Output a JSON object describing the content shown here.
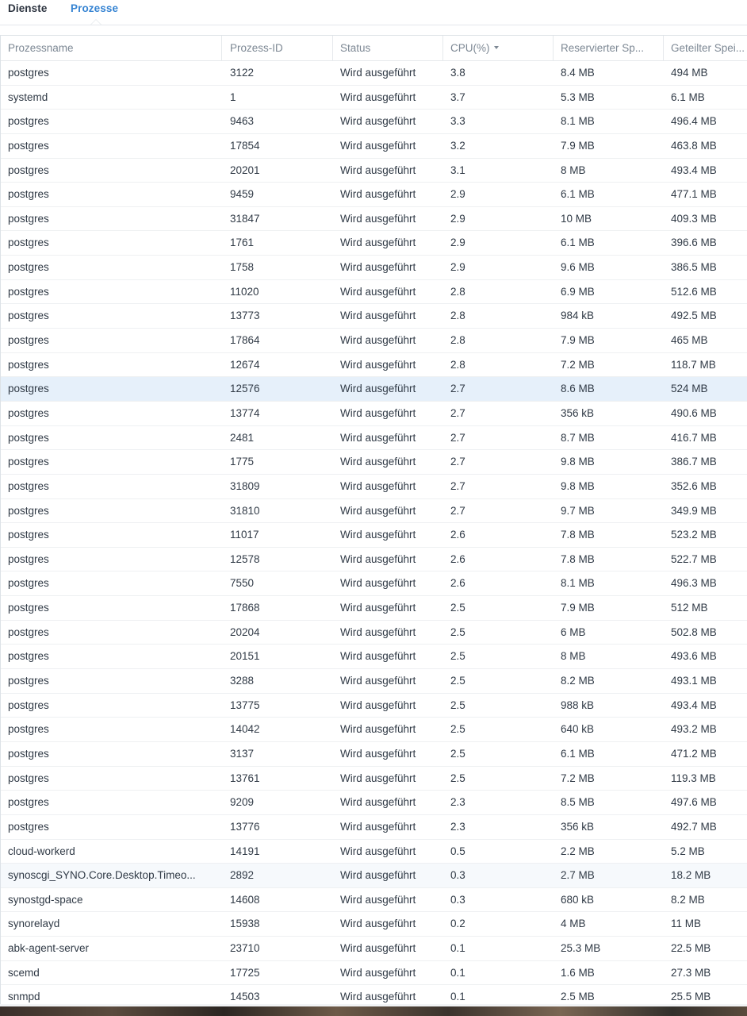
{
  "tabs": {
    "dienste": "Dienste",
    "prozesse": "Prozesse",
    "active": "Prozesse"
  },
  "table": {
    "columns": [
      "Prozessname",
      "Prozess-ID",
      "Status",
      "CPU(%)",
      "Reservierter Sp...",
      "Geteilter Spei..."
    ],
    "sort_column": "CPU(%)",
    "selected_row_index": 13,
    "rows": [
      [
        "postgres",
        "3122",
        "Wird ausgeführt",
        "3.8",
        "8.4 MB",
        "494 MB"
      ],
      [
        "systemd",
        "1",
        "Wird ausgeführt",
        "3.7",
        "5.3 MB",
        "6.1 MB"
      ],
      [
        "postgres",
        "9463",
        "Wird ausgeführt",
        "3.3",
        "8.1 MB",
        "496.4 MB"
      ],
      [
        "postgres",
        "17854",
        "Wird ausgeführt",
        "3.2",
        "7.9 MB",
        "463.8 MB"
      ],
      [
        "postgres",
        "20201",
        "Wird ausgeführt",
        "3.1",
        "8 MB",
        "493.4 MB"
      ],
      [
        "postgres",
        "9459",
        "Wird ausgeführt",
        "2.9",
        "6.1 MB",
        "477.1 MB"
      ],
      [
        "postgres",
        "31847",
        "Wird ausgeführt",
        "2.9",
        "10 MB",
        "409.3 MB"
      ],
      [
        "postgres",
        "1761",
        "Wird ausgeführt",
        "2.9",
        "6.1 MB",
        "396.6 MB"
      ],
      [
        "postgres",
        "1758",
        "Wird ausgeführt",
        "2.9",
        "9.6 MB",
        "386.5 MB"
      ],
      [
        "postgres",
        "11020",
        "Wird ausgeführt",
        "2.8",
        "6.9 MB",
        "512.6 MB"
      ],
      [
        "postgres",
        "13773",
        "Wird ausgeführt",
        "2.8",
        "984 kB",
        "492.5 MB"
      ],
      [
        "postgres",
        "17864",
        "Wird ausgeführt",
        "2.8",
        "7.9 MB",
        "465 MB"
      ],
      [
        "postgres",
        "12674",
        "Wird ausgeführt",
        "2.8",
        "7.2 MB",
        "118.7 MB"
      ],
      [
        "postgres",
        "12576",
        "Wird ausgeführt",
        "2.7",
        "8.6 MB",
        "524 MB"
      ],
      [
        "postgres",
        "13774",
        "Wird ausgeführt",
        "2.7",
        "356 kB",
        "490.6 MB"
      ],
      [
        "postgres",
        "2481",
        "Wird ausgeführt",
        "2.7",
        "8.7 MB",
        "416.7 MB"
      ],
      [
        "postgres",
        "1775",
        "Wird ausgeführt",
        "2.7",
        "9.8 MB",
        "386.7 MB"
      ],
      [
        "postgres",
        "31809",
        "Wird ausgeführt",
        "2.7",
        "9.8 MB",
        "352.6 MB"
      ],
      [
        "postgres",
        "31810",
        "Wird ausgeführt",
        "2.7",
        "9.7 MB",
        "349.9 MB"
      ],
      [
        "postgres",
        "11017",
        "Wird ausgeführt",
        "2.6",
        "7.8 MB",
        "523.2 MB"
      ],
      [
        "postgres",
        "12578",
        "Wird ausgeführt",
        "2.6",
        "7.8 MB",
        "522.7 MB"
      ],
      [
        "postgres",
        "7550",
        "Wird ausgeführt",
        "2.6",
        "8.1 MB",
        "496.3 MB"
      ],
      [
        "postgres",
        "17868",
        "Wird ausgeführt",
        "2.5",
        "7.9 MB",
        "512 MB"
      ],
      [
        "postgres",
        "20204",
        "Wird ausgeführt",
        "2.5",
        "6 MB",
        "502.8 MB"
      ],
      [
        "postgres",
        "20151",
        "Wird ausgeführt",
        "2.5",
        "8 MB",
        "493.6 MB"
      ],
      [
        "postgres",
        "3288",
        "Wird ausgeführt",
        "2.5",
        "8.2 MB",
        "493.1 MB"
      ],
      [
        "postgres",
        "13775",
        "Wird ausgeführt",
        "2.5",
        "988 kB",
        "493.4 MB"
      ],
      [
        "postgres",
        "14042",
        "Wird ausgeführt",
        "2.5",
        "640 kB",
        "493.2 MB"
      ],
      [
        "postgres",
        "3137",
        "Wird ausgeführt",
        "2.5",
        "6.1 MB",
        "471.2 MB"
      ],
      [
        "postgres",
        "13761",
        "Wird ausgeführt",
        "2.5",
        "7.2 MB",
        "119.3 MB"
      ],
      [
        "postgres",
        "9209",
        "Wird ausgeführt",
        "2.3",
        "8.5 MB",
        "497.6 MB"
      ],
      [
        "postgres",
        "13776",
        "Wird ausgeführt",
        "2.3",
        "356 kB",
        "492.7 MB"
      ],
      [
        "cloud-workerd",
        "14191",
        "Wird ausgeführt",
        "0.5",
        "2.2 MB",
        "5.2 MB"
      ],
      [
        "synoscgi_SYNO.Core.Desktop.Timeo...",
        "2892",
        "Wird ausgeführt",
        "0.3",
        "2.7 MB",
        "18.2 MB"
      ],
      [
        "synostgd-space",
        "14608",
        "Wird ausgeführt",
        "0.3",
        "680 kB",
        "8.2 MB"
      ],
      [
        "synorelayd",
        "15938",
        "Wird ausgeführt",
        "0.2",
        "4 MB",
        "11 MB"
      ],
      [
        "abk-agent-server",
        "23710",
        "Wird ausgeführt",
        "0.1",
        "25.3 MB",
        "22.5 MB"
      ],
      [
        "scemd",
        "17725",
        "Wird ausgeführt",
        "0.1",
        "1.6 MB",
        "27.3 MB"
      ],
      [
        "snmpd",
        "14503",
        "Wird ausgeführt",
        "0.1",
        "2.5 MB",
        "25.5 MB"
      ]
    ]
  },
  "colors": {
    "accent": "#3583d2",
    "selected_row": "#e6f0fa",
    "text": "#303a46",
    "header_text": "#7d8894"
  }
}
